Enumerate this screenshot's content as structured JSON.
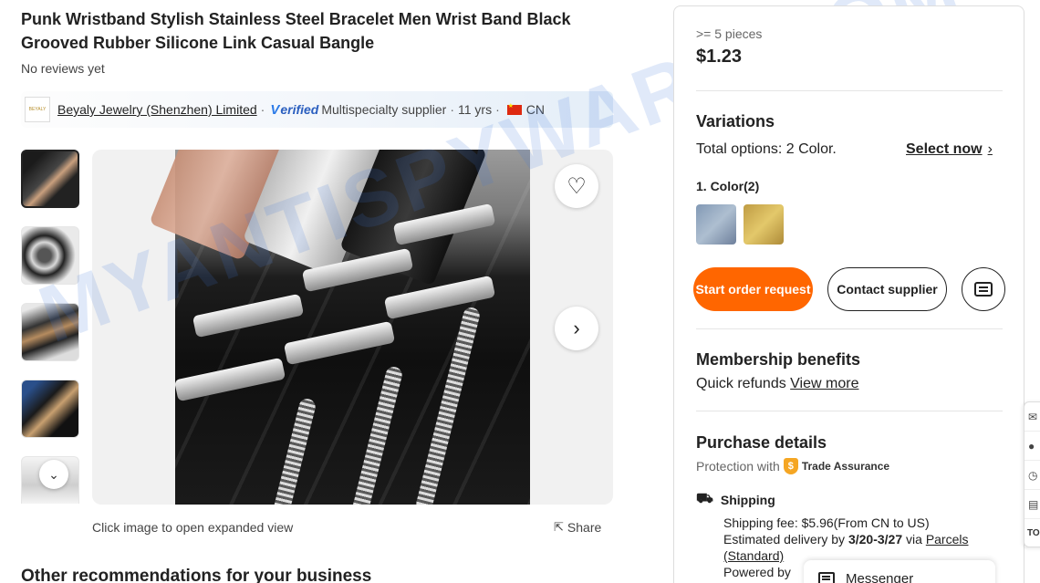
{
  "product": {
    "title": "Punk Wristband Stylish Stainless Steel Bracelet Men Wrist Band Black Grooved Rubber Silicone Link Casual Bangle",
    "reviews": "No reviews yet"
  },
  "supplier": {
    "logo_text": "BEYALY",
    "name": "Beyaly Jewelry (Shenzhen) Limited",
    "separator": "·",
    "verified_check": "V",
    "verified_label": "erified",
    "type": "Multispecialty supplier",
    "years": "11 yrs",
    "country": "CN"
  },
  "gallery": {
    "caption": "Click image to open expanded view",
    "share_label": "Share",
    "thumb_scroll": "⌄"
  },
  "watermark": "MYANTISPYWARE.COM",
  "sections": {
    "other_recommendations": "Other recommendations for your business"
  },
  "pricing": {
    "quantity": ">= 5 pieces",
    "price": "$1.23"
  },
  "variations": {
    "heading": "Variations",
    "total": "Total options: 2 Color.",
    "select_now": "Select now",
    "select_chevron": "›",
    "color_label": "1. Color(2)"
  },
  "actions": {
    "start_order": "Start order request",
    "contact_supplier": "Contact supplier"
  },
  "membership": {
    "heading": "Membership benefits",
    "text": "Quick refunds",
    "link": "View more"
  },
  "purchase": {
    "heading": "Purchase details",
    "protection": "Protection with",
    "trade_assurance": "Trade Assurance",
    "shipping_heading": "Shipping",
    "shipping_fee": "Shipping fee: $5.96(From CN to US)",
    "estimated_prefix": "Estimated delivery by",
    "estimated_dates": "3/20-3/27",
    "via": "via",
    "carrier": "Parcels",
    "carrier_type": "(Standard)",
    "powered_by": "Powered by"
  },
  "messenger": {
    "label": "Messenger"
  },
  "side_tools": {
    "top_label": "TO"
  },
  "colors": {
    "accent": "#ff6600",
    "verified": "#2b5fbf",
    "trade_assurance": "#f5a623"
  }
}
